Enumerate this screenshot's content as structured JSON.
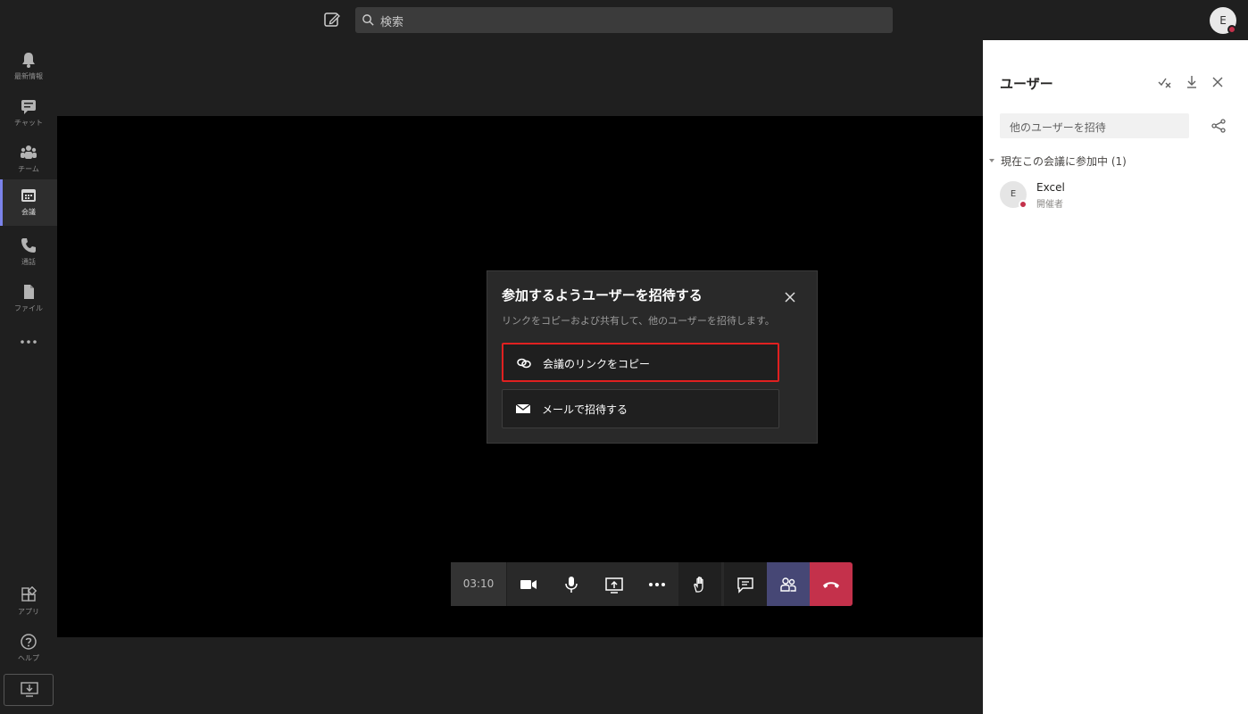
{
  "topbar": {
    "search_placeholder": "検索",
    "user_initial": "E"
  },
  "rail": {
    "items": [
      {
        "label": "最新情報",
        "icon": "bell-icon"
      },
      {
        "label": "チャット",
        "icon": "chat-icon"
      },
      {
        "label": "チーム",
        "icon": "teams-icon"
      },
      {
        "label": "会議",
        "icon": "calendar-icon",
        "active": true
      },
      {
        "label": "通話",
        "icon": "phone-icon"
      },
      {
        "label": "ファイル",
        "icon": "file-icon"
      },
      {
        "label": "アプリ",
        "icon": "apps-icon"
      },
      {
        "label": "ヘルプ",
        "icon": "help-icon"
      }
    ]
  },
  "dialog": {
    "title": "参加するようユーザーを招待する",
    "subtitle": "リンクをコピーおよび共有して、他のユーザーを招待します。",
    "copy_link_label": "会議のリンクをコピー",
    "email_label": "メールで招待する"
  },
  "callbar": {
    "timer": "03:10"
  },
  "panel": {
    "title": "ユーザー",
    "invite_placeholder": "他のユーザーを招待",
    "section_title": "現在この会議に参加中 (1)",
    "participant": {
      "initial": "E",
      "name": "Excel",
      "role": "開催者"
    }
  },
  "colors": {
    "accent": "#7b83eb",
    "people_button": "#464775",
    "hangup": "#c4314b",
    "highlight_border": "#e02020",
    "presence_busy": "#c4314b"
  }
}
